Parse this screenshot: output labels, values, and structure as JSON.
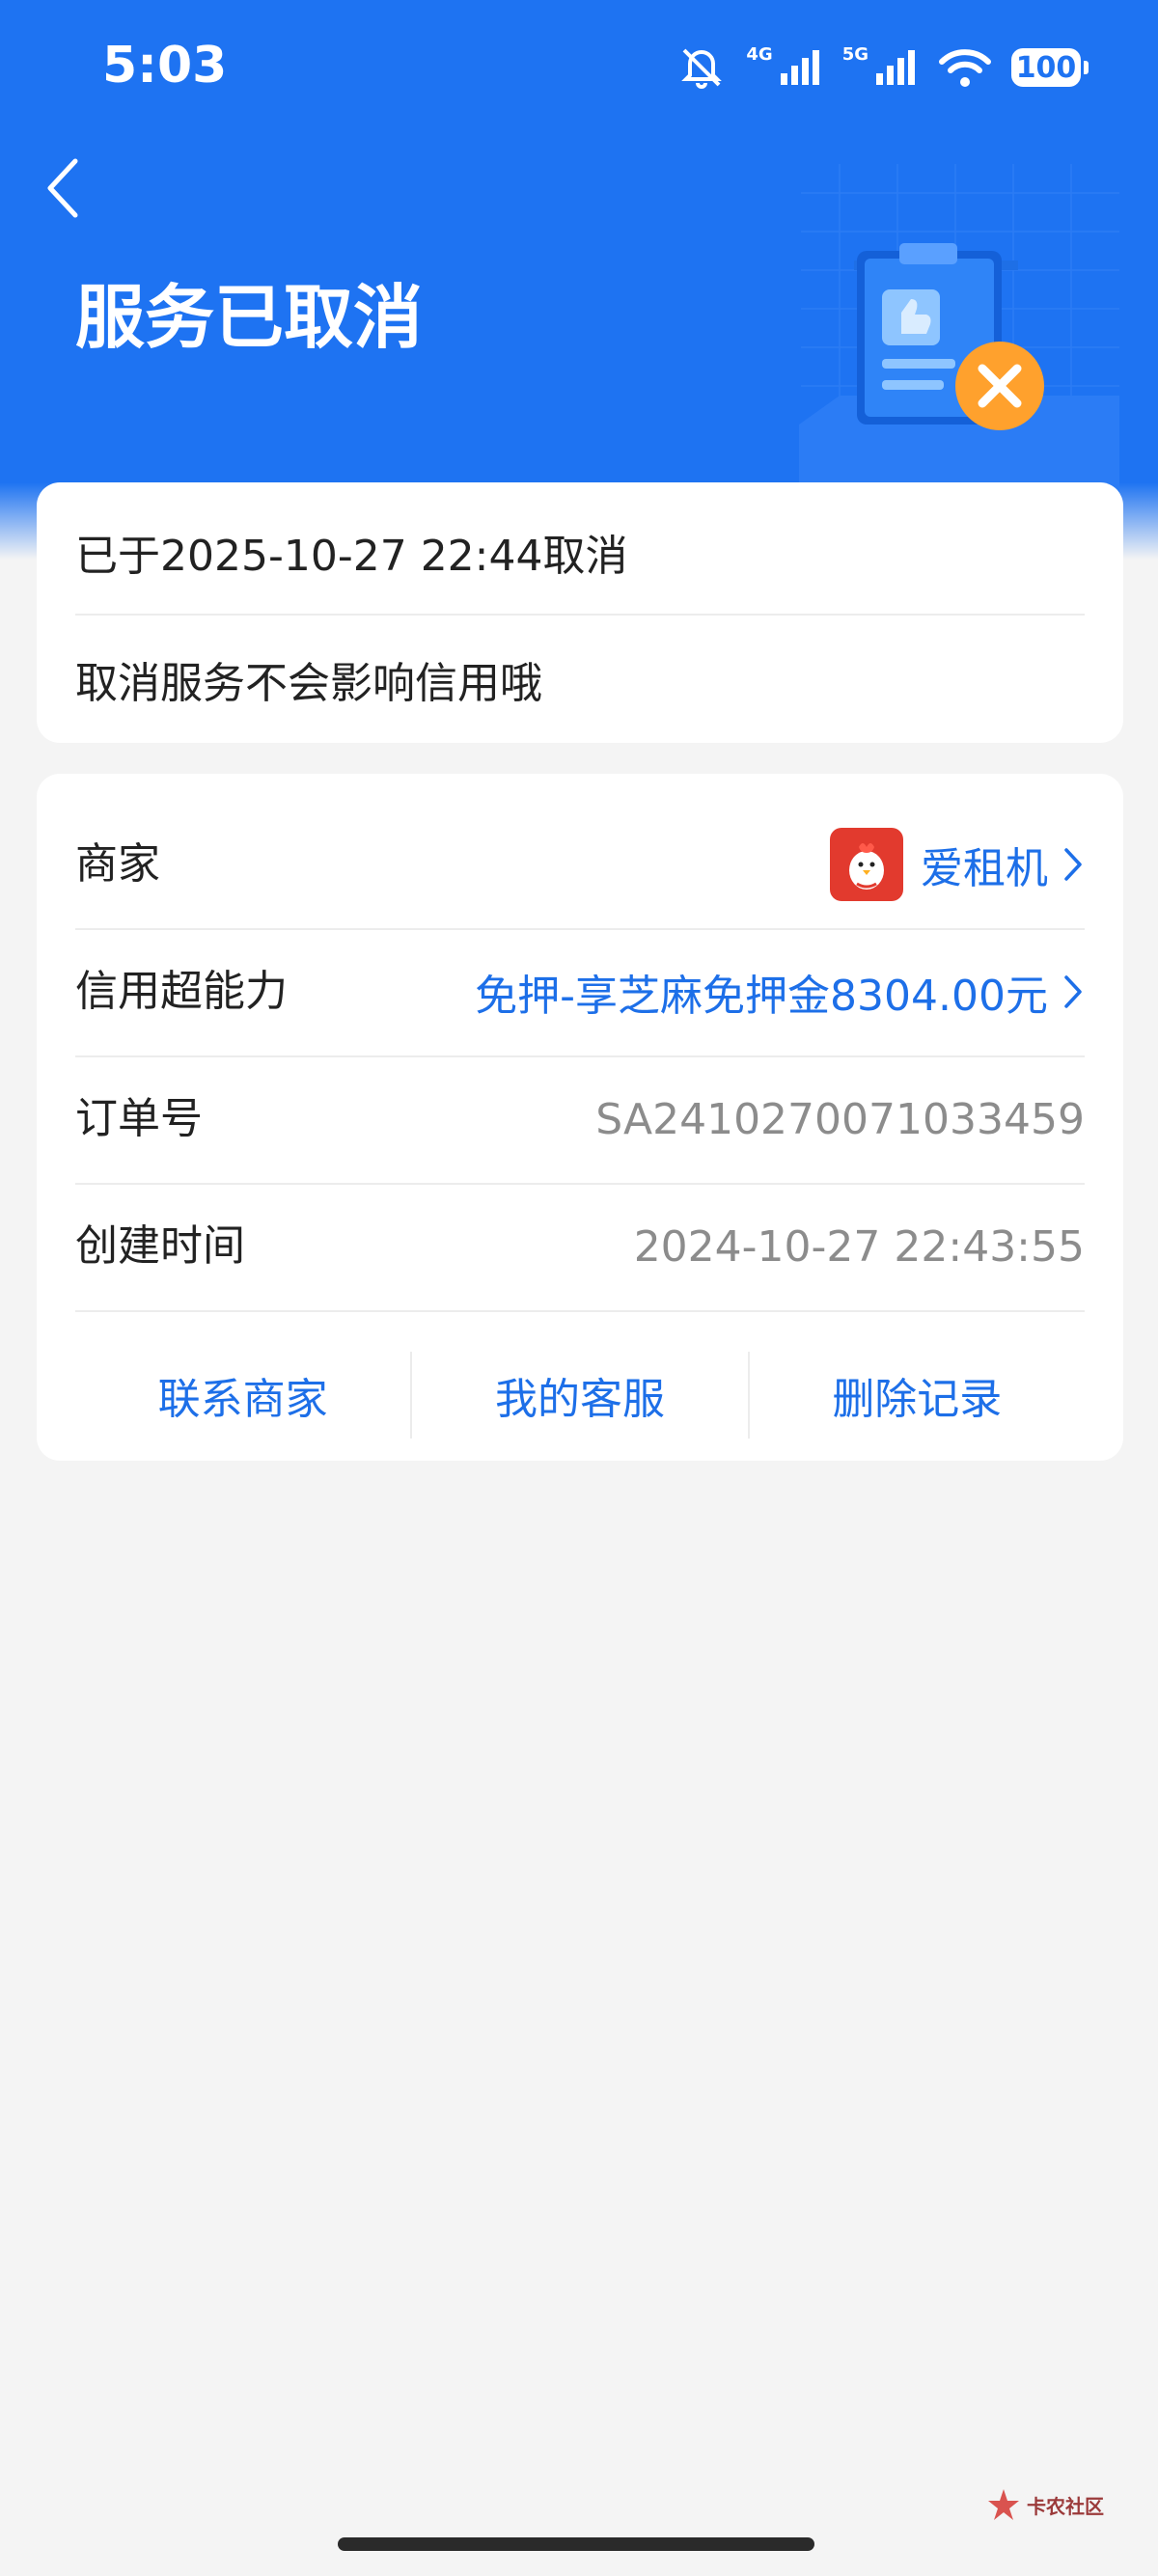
{
  "status_bar": {
    "time": "5:03",
    "net1": "4G",
    "net2": "5G",
    "battery": "100"
  },
  "header": {
    "title": "服务已取消"
  },
  "cancel_info": {
    "cancel_time": "已于2025-10-27 22:44取消",
    "note": "取消服务不会影响信用哦"
  },
  "details": {
    "merchant_label": "商家",
    "merchant_value": "爱租机",
    "credit_label": "信用超能力",
    "credit_value": "免押-享芝麻免押金8304.00元",
    "order_label": "订单号",
    "order_value": "SA2410270071033459",
    "created_label": "创建时间",
    "created_value": "2024-10-27 22:43:55"
  },
  "actions": {
    "contact_merchant": "联系商家",
    "my_service": "我的客服",
    "delete_record": "删除记录"
  },
  "watermark": {
    "text": "卡农社区"
  },
  "colors": {
    "header_bg": "#1e73f2",
    "link_blue": "#1d6fe8",
    "page_bg": "#f4f4f4"
  }
}
